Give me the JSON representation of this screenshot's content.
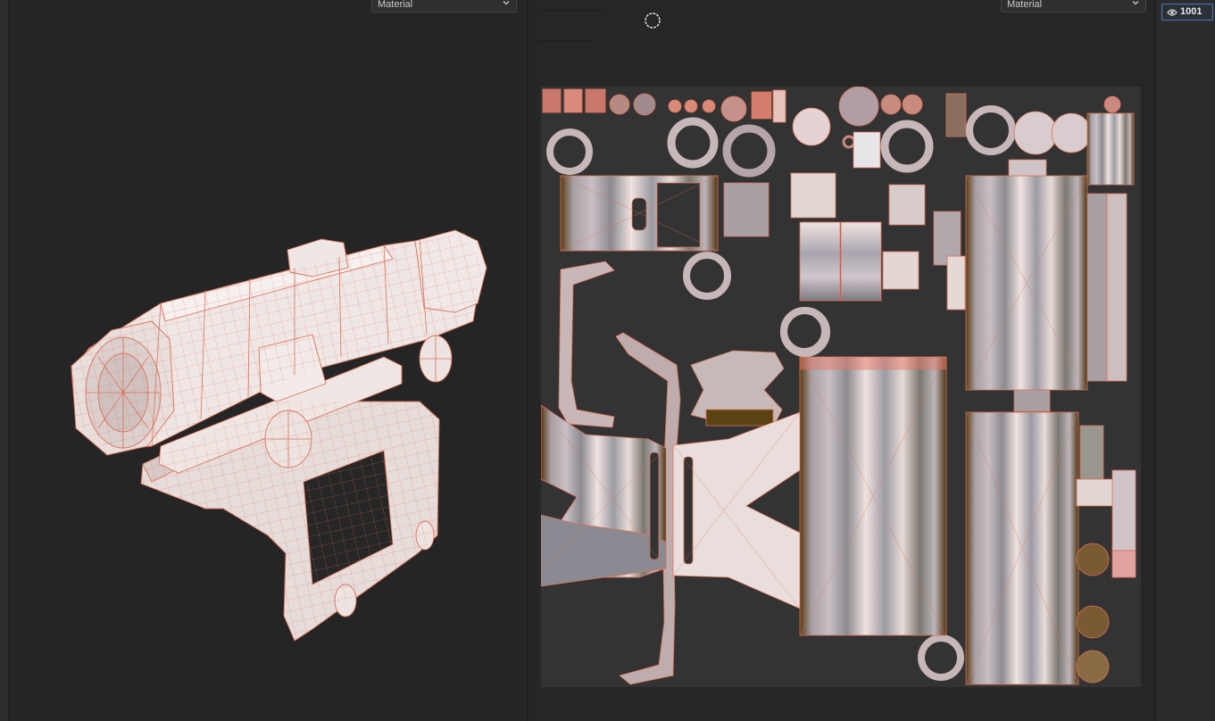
{
  "left_viewport": {
    "material_dropdown": "Material"
  },
  "uv_viewport": {
    "material_dropdown": "Material"
  },
  "udim": {
    "tile_number": "1001"
  },
  "icons": [
    "chevron-down-icon",
    "eye-icon",
    "brush-cursor-icon"
  ],
  "colors": {
    "mesh_fill": "#e9dfdd",
    "wireframe": "#d9735a",
    "uv_background": "#333333",
    "panel_bg": "#262626",
    "accent_border": "#4f79b8"
  }
}
